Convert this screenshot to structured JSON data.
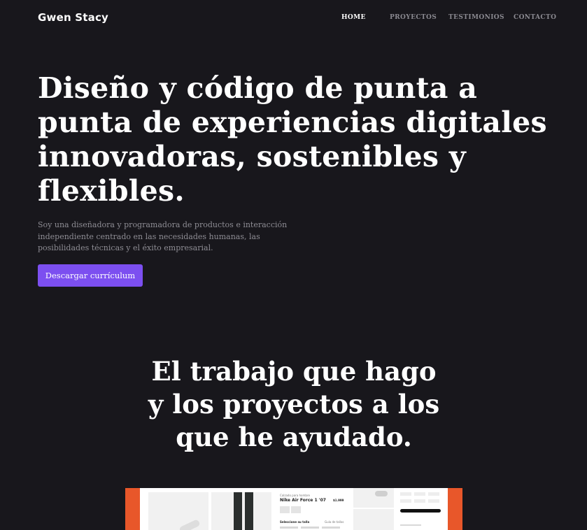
{
  "brand": "Gwen Stacy",
  "nav": {
    "items": [
      {
        "label": "HOME",
        "active": true
      },
      {
        "label": "PROYECTOS",
        "active": false
      },
      {
        "label": "TESTIMONIOS",
        "active": false
      },
      {
        "label": "CONTACTO",
        "active": false
      }
    ]
  },
  "hero": {
    "title_lines": [
      "Diseño y código de punta a",
      "punta de experiencias digitales",
      "innovadoras, sostenibles y",
      "flexibles."
    ],
    "subtitle_lines": [
      "Soy una diseñadora y programadora de productos e interacción",
      "independiente centrado en las necesidades humanas, las",
      "posibilidades técnicas y el éxito empresarial."
    ],
    "cta_label": "Descargar currículum"
  },
  "work": {
    "title_lines": [
      "El trabajo que hago",
      "y los proyectos a los",
      "que he ayudado."
    ]
  },
  "preview": {
    "category": "Calzado para hombre",
    "product": "Nike Air Force 1 '07",
    "price": "$1.999",
    "size_label": "Seleccione su talla",
    "size_guide": "Guía de tallas"
  },
  "colors": {
    "background": "#18171c",
    "accent": "#7c4ff0",
    "muted_text": "#8e8d94",
    "preview_frame": "#e8572a"
  }
}
